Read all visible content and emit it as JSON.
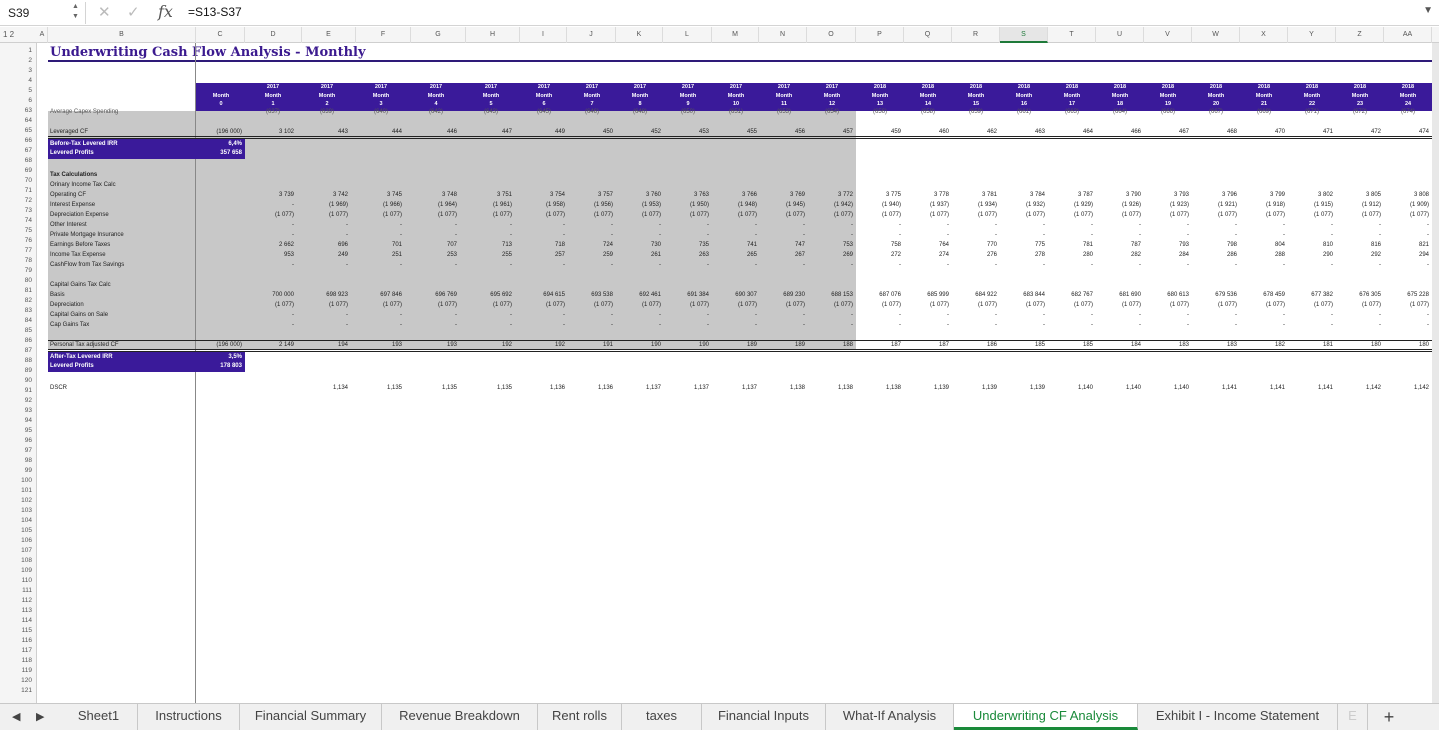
{
  "formula_bar": {
    "name_box": "S39",
    "spin": "▲\n▼",
    "cancel": "✕",
    "confirm": "✓",
    "fx": "fx",
    "formula": "=S13-S37",
    "dropdown": "▼"
  },
  "outline_levels": "1 2",
  "columns": [
    "A",
    "B",
    "C",
    "D",
    "E",
    "F",
    "G",
    "H",
    "I",
    "J",
    "K",
    "L",
    "M",
    "N",
    "O",
    "P",
    "Q",
    "R",
    "S",
    "T",
    "U",
    "V",
    "W",
    "X",
    "Y",
    "Z",
    "AA"
  ],
  "selected_column": "S",
  "rows": [
    "1",
    "2",
    "3",
    "4",
    "5",
    "6",
    "63",
    "64",
    "65",
    "66",
    "67",
    "68",
    "69",
    "70",
    "71",
    "72",
    "73",
    "74",
    "75",
    "76",
    "77",
    "78",
    "79",
    "80",
    "81",
    "82",
    "83",
    "84",
    "85",
    "86",
    "87",
    "88",
    "89",
    "90",
    "91",
    "92",
    "93",
    "94",
    "95",
    "96",
    "97",
    "98",
    "99",
    "100",
    "101",
    "102",
    "103",
    "104",
    "105",
    "106",
    "107",
    "108",
    "109",
    "110",
    "111",
    "112",
    "113",
    "114",
    "115",
    "116",
    "117",
    "118",
    "119",
    "120",
    "121"
  ],
  "title": "Underwriting Cash Flow Analysis - Monthly",
  "month0": {
    "label": "Month",
    "num": "0"
  },
  "month_headers": [
    {
      "year": "2017",
      "label": "Month",
      "num": "1"
    },
    {
      "year": "2017",
      "label": "Month",
      "num": "2"
    },
    {
      "year": "2017",
      "label": "Month",
      "num": "3"
    },
    {
      "year": "2017",
      "label": "Month",
      "num": "4"
    },
    {
      "year": "2017",
      "label": "Month",
      "num": "5"
    },
    {
      "year": "2017",
      "label": "Month",
      "num": "6"
    },
    {
      "year": "2017",
      "label": "Month",
      "num": "7"
    },
    {
      "year": "2017",
      "label": "Month",
      "num": "8"
    },
    {
      "year": "2017",
      "label": "Month",
      "num": "9"
    },
    {
      "year": "2017",
      "label": "Month",
      "num": "10"
    },
    {
      "year": "2017",
      "label": "Month",
      "num": "11"
    },
    {
      "year": "2017",
      "label": "Month",
      "num": "12"
    },
    {
      "year": "2018",
      "label": "Month",
      "num": "13"
    },
    {
      "year": "2018",
      "label": "Month",
      "num": "14"
    },
    {
      "year": "2018",
      "label": "Month",
      "num": "15"
    },
    {
      "year": "2018",
      "label": "Month",
      "num": "16"
    },
    {
      "year": "2018",
      "label": "Month",
      "num": "17"
    },
    {
      "year": "2018",
      "label": "Month",
      "num": "18"
    },
    {
      "year": "2018",
      "label": "Month",
      "num": "19"
    },
    {
      "year": "2018",
      "label": "Month",
      "num": "20"
    },
    {
      "year": "2018",
      "label": "Month",
      "num": "21"
    },
    {
      "year": "2018",
      "label": "Month",
      "num": "22"
    },
    {
      "year": "2018",
      "label": "Month",
      "num": "23"
    },
    {
      "year": "2018",
      "label": "Month",
      "num": "24"
    }
  ],
  "capex_row": {
    "label": "Average Capex Spending",
    "values": [
      "(637)",
      "(639)",
      "(640)",
      "(642)",
      "(643)",
      "(645)",
      "(646)",
      "(648)",
      "(650)",
      "(651)",
      "(653)",
      "(654)",
      "(656)",
      "(658)",
      "(659)",
      "(661)",
      "(663)",
      "(664)",
      "(666)",
      "(667)",
      "(669)",
      "(671)",
      "(672)",
      "(674)"
    ]
  },
  "leveraged_cf": {
    "label": "Leveraged CF",
    "c": "(196 000)",
    "values": [
      "3 102",
      "443",
      "444",
      "446",
      "447",
      "449",
      "450",
      "452",
      "453",
      "455",
      "456",
      "457",
      "459",
      "460",
      "462",
      "463",
      "464",
      "466",
      "467",
      "468",
      "470",
      "471",
      "472",
      "474"
    ]
  },
  "before_tax": {
    "irr_label": "Before-Tax Levered IRR",
    "irr": "6,4%",
    "profit_label": "Levered Profits",
    "profit": "357 658"
  },
  "tax_section": {
    "heading": "Tax Calculations",
    "ordinary": "Orinary Income Tax Calc",
    "rows": [
      {
        "label": "Operating CF",
        "values": [
          "3 739",
          "3 742",
          "3 745",
          "3 748",
          "3 751",
          "3 754",
          "3 757",
          "3 760",
          "3 763",
          "3 766",
          "3 769",
          "3 772",
          "3 775",
          "3 778",
          "3 781",
          "3 784",
          "3 787",
          "3 790",
          "3 793",
          "3 796",
          "3 799",
          "3 802",
          "3 805",
          "3 808"
        ]
      },
      {
        "label": "Interest Expense",
        "values": [
          "-",
          "(1 969)",
          "(1 966)",
          "(1 964)",
          "(1 961)",
          "(1 958)",
          "(1 956)",
          "(1 953)",
          "(1 950)",
          "(1 948)",
          "(1 945)",
          "(1 942)",
          "(1 940)",
          "(1 937)",
          "(1 934)",
          "(1 932)",
          "(1 929)",
          "(1 926)",
          "(1 923)",
          "(1 921)",
          "(1 918)",
          "(1 915)",
          "(1 912)",
          "(1 909)"
        ]
      },
      {
        "label": "Depreciation Expense",
        "values": [
          "(1 077)",
          "(1 077)",
          "(1 077)",
          "(1 077)",
          "(1 077)",
          "(1 077)",
          "(1 077)",
          "(1 077)",
          "(1 077)",
          "(1 077)",
          "(1 077)",
          "(1 077)",
          "(1 077)",
          "(1 077)",
          "(1 077)",
          "(1 077)",
          "(1 077)",
          "(1 077)",
          "(1 077)",
          "(1 077)",
          "(1 077)",
          "(1 077)",
          "(1 077)",
          "(1 077)"
        ]
      },
      {
        "label": "Other Interest",
        "values": [
          "-",
          "-",
          "-",
          "-",
          "-",
          "-",
          "-",
          "-",
          "-",
          "-",
          "-",
          "-",
          "-",
          "-",
          "-",
          "-",
          "-",
          "-",
          "-",
          "-",
          "-",
          "-",
          "-",
          "-"
        ]
      },
      {
        "label": "Private Mortgage Insurance",
        "values": [
          "-",
          "-",
          "-",
          "-",
          "-",
          "-",
          "-",
          "-",
          "-",
          "-",
          "-",
          "-",
          "-",
          "-",
          "-",
          "-",
          "-",
          "-",
          "-",
          "-",
          "-",
          "-",
          "-",
          "-"
        ]
      },
      {
        "label": "Earnings Before Taxes",
        "values": [
          "2 662",
          "696",
          "701",
          "707",
          "713",
          "718",
          "724",
          "730",
          "735",
          "741",
          "747",
          "753",
          "758",
          "764",
          "770",
          "775",
          "781",
          "787",
          "793",
          "798",
          "804",
          "810",
          "816",
          "821"
        ]
      },
      {
        "label": "Income Tax Expense",
        "values": [
          "953",
          "249",
          "251",
          "253",
          "255",
          "257",
          "259",
          "261",
          "263",
          "265",
          "267",
          "269",
          "272",
          "274",
          "276",
          "278",
          "280",
          "282",
          "284",
          "286",
          "288",
          "290",
          "292",
          "294"
        ]
      },
      {
        "label": "CashFlow from Tax Savings",
        "values": [
          "-",
          "-",
          "-",
          "-",
          "-",
          "-",
          "-",
          "-",
          "-",
          "-",
          "-",
          "-",
          "-",
          "-",
          "-",
          "-",
          "-",
          "-",
          "-",
          "-",
          "-",
          "-",
          "-",
          "-"
        ]
      }
    ]
  },
  "cap_gains": {
    "heading": "Capital Gains Tax Calc",
    "rows": [
      {
        "label": "Basis",
        "values": [
          "700 000",
          "698 923",
          "697 846",
          "696 769",
          "695 692",
          "694 615",
          "693 538",
          "692 461",
          "691 384",
          "690 307",
          "689 230",
          "688 153",
          "687 076",
          "685 999",
          "684 922",
          "683 844",
          "682 767",
          "681 690",
          "680 613",
          "679 536",
          "678 459",
          "677 382",
          "676 305",
          "675 228"
        ]
      },
      {
        "label": "Depreciation",
        "values": [
          "(1 077)",
          "(1 077)",
          "(1 077)",
          "(1 077)",
          "(1 077)",
          "(1 077)",
          "(1 077)",
          "(1 077)",
          "(1 077)",
          "(1 077)",
          "(1 077)",
          "(1 077)",
          "(1 077)",
          "(1 077)",
          "(1 077)",
          "(1 077)",
          "(1 077)",
          "(1 077)",
          "(1 077)",
          "(1 077)",
          "(1 077)",
          "(1 077)",
          "(1 077)",
          "(1 077)"
        ]
      },
      {
        "label": "Capital Gains on Sale",
        "values": [
          "-",
          "-",
          "-",
          "-",
          "-",
          "-",
          "-",
          "-",
          "-",
          "-",
          "-",
          "-",
          "-",
          "-",
          "-",
          "-",
          "-",
          "-",
          "-",
          "-",
          "-",
          "-",
          "-",
          "-"
        ]
      },
      {
        "label": "Cap Gains Tax",
        "values": [
          "-",
          "-",
          "-",
          "-",
          "-",
          "-",
          "-",
          "-",
          "-",
          "-",
          "-",
          "-",
          "-",
          "-",
          "-",
          "-",
          "-",
          "-",
          "-",
          "-",
          "-",
          "-",
          "-",
          "-"
        ]
      }
    ]
  },
  "personal_tax": {
    "label": "Personal Tax adjusted CF",
    "c": "(196 000)",
    "values": [
      "2 149",
      "194",
      "193",
      "193",
      "192",
      "192",
      "191",
      "190",
      "190",
      "189",
      "189",
      "188",
      "187",
      "187",
      "186",
      "185",
      "185",
      "184",
      "183",
      "183",
      "182",
      "181",
      "180",
      "180"
    ]
  },
  "after_tax": {
    "irr_label": "After-Tax Levered IRR",
    "irr": "3,5%",
    "profit_label": "Levered Profits",
    "profit": "178 803"
  },
  "dscr": {
    "label": "DSCR",
    "values": [
      "",
      "1,134",
      "1,135",
      "1,135",
      "1,135",
      "1,136",
      "1,136",
      "1,137",
      "1,137",
      "1,137",
      "1,138",
      "1,138",
      "1,138",
      "1,139",
      "1,139",
      "1,139",
      "1,140",
      "1,140",
      "1,140",
      "1,141",
      "1,141",
      "1,141",
      "1,142",
      "1,142"
    ]
  },
  "sheet_tabs": [
    "Sheet1",
    "Instructions",
    "Financial Summary",
    "Revenue Breakdown",
    "Rent rolls",
    "taxes",
    "Financial Inputs",
    "What-If Analysis",
    "Underwriting CF Analysis",
    "Exhibit I - Income Statement",
    "E"
  ],
  "active_tab": "Underwriting CF Analysis",
  "tab_nav": {
    "prev": "◀",
    "next": "▶",
    "add": "+"
  },
  "colors": {
    "header_purple": "#3a1a9a",
    "title_purple": "#3b1a8f",
    "active_tab_green": "#1a8a3a",
    "gray_band": "#c8c8c8"
  }
}
